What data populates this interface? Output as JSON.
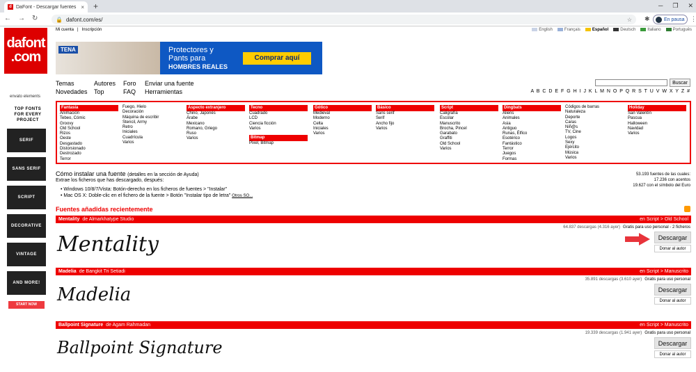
{
  "browser": {
    "tab_title": "DaFont - Descargar fuentes",
    "url": "dafont.com/es/",
    "profile": "En pausa"
  },
  "site": {
    "logo_line1": "dafont",
    "logo_line2": ".com",
    "toplinks": [
      "Mi cuenta",
      "Inscripción"
    ],
    "languages": [
      {
        "name": "English",
        "color": "#c9d3e6"
      },
      {
        "name": "Français",
        "color": "#9ab1d9"
      },
      {
        "name": "Español",
        "color": "#f5c400",
        "selected": true
      },
      {
        "name": "Deutsch",
        "color": "#333333"
      },
      {
        "name": "Italiano",
        "color": "#3a9a3a"
      },
      {
        "name": "Português",
        "color": "#2f7d32"
      }
    ],
    "ad": {
      "brand": "TENA",
      "line1": "Protectores y",
      "line2": "Pants para",
      "line3": "HOMBRES REALES",
      "cta": "Comprar aquí"
    },
    "envato": {
      "logo": "envato elements",
      "headline": "TOP FONTS FOR EVERY PROJECT",
      "tiles": [
        "SERIF",
        "SANS SERIF",
        "SCRIPT",
        "DECORATIVE",
        "VINTAGE",
        "AND MORE!"
      ],
      "cta": "START NOW"
    },
    "menu": [
      {
        "label": "Temas"
      },
      {
        "label": "Autores"
      },
      {
        "label": "Foro"
      },
      {
        "label": "Enviar una fuente"
      },
      {
        "label": "Novedades"
      },
      {
        "label": "Top"
      },
      {
        "label": "FAQ"
      },
      {
        "label": "Herramientas"
      }
    ],
    "search_button": "Buscar",
    "alphabet": "A B C D E F G H I J K L M N O P Q R S T U V W X Y Z #",
    "categories": [
      {
        "title": "Fantasía",
        "items": [
          "Animación",
          "Tebeo, Cómic",
          "Groovy",
          "Old School",
          "Rizos",
          "Oeste",
          "Desgastado",
          "Distorsionado",
          "Destrozado",
          "Terror"
        ]
      },
      {
        "title": "",
        "items": [
          "Fuego, Hielo",
          "Decoración",
          "Máquina de escribir",
          "Stencil, Army",
          "Retro",
          "Iniciales",
          "Cuadrícula",
          "Varios"
        ]
      },
      {
        "title": "Aspecto extranjero",
        "items": [
          "Chino, Japonés",
          "Árabe",
          "Mexicano",
          "Romano, Griego",
          "Ruso",
          "Varios"
        ]
      },
      {
        "title": "Tecno",
        "items": [
          "Cuadrado",
          "LCD",
          "Ciencia ficción",
          "Varios"
        ],
        "sub": {
          "title": "Bitmap",
          "items": [
            "Pixel, Bitmap"
          ]
        }
      },
      {
        "title": "Gótico",
        "items": [
          "Medieval",
          "Moderno",
          "Celta",
          "Iniciales",
          "Varios"
        ]
      },
      {
        "title": "Básico",
        "items": [
          "Sans serif",
          "Serif",
          "Ancho fijo",
          "Varios"
        ]
      },
      {
        "title": "Script",
        "items": [
          "Caligrafía",
          "Escolar",
          "Manuscrito",
          "Brocha, Pincel",
          "Garabato",
          "Graffiti",
          "Old School",
          "Varios"
        ]
      },
      {
        "title": "Dingbats",
        "items": [
          "Aliens",
          "Animales",
          "Asia",
          "Antiguo",
          "Runas, Élfico",
          "Esotérico",
          "Fantástico",
          "Terror",
          "Juegos",
          "Formas"
        ]
      },
      {
        "title": "",
        "items": [
          "Códigos de barras",
          "Naturaleza",
          "Deporte",
          "Caras",
          "Niñ@s",
          "TV, Cine",
          "Logos",
          "Sexy",
          "Ejército",
          "Música",
          "Varios"
        ]
      },
      {
        "title": "Holiday",
        "items": [
          "San Valentín",
          "Pascua",
          "Halloween",
          "Navidad",
          "Varios"
        ]
      }
    ],
    "howto": {
      "title": "Cómo instalar una fuente",
      "note": "(detalles en la sección de Ayuda)",
      "sub": "Extrae los ficheros que has descargado, después:",
      "win": "Windows 10/8/7/Vista: Botón-derecho en los ficheros de fuentes > \"Instalar\"",
      "mac": "Mac OS X: Doble-clic en el fichero de la fuente > Botón \"Instalar tipo de letra\"",
      "other": "Otros SO..."
    },
    "stats": {
      "line1": "53.193 fuentes de las cuales:",
      "line2": "17.236 con acentos",
      "line3": "19.627 con el símbolo del Euro"
    },
    "recent_title": "Fuentes añadidas recientemente",
    "fonts": [
      {
        "name": "Mentality",
        "author": "de Almarkhatype Studio",
        "category": "en Script > Old School",
        "downloads": "64.837 descargas (4.316 ayer)",
        "license": "Gratis para uso personal - 2 ficheros",
        "sample": "Mentality",
        "download": "Descargar",
        "donate": "Donar al autor"
      },
      {
        "name": "Madelia",
        "author": "de Bangkit Tri Setiadi",
        "category": "en Script > Manuscrito",
        "downloads": "35.891 descargas (3.610 ayer)",
        "license": "Gratis para uso personal",
        "sample": "Madelia",
        "download": "Descargar",
        "donate": "Donar al autor"
      },
      {
        "name": "Ballpoint Signature",
        "author": "de Agam Rahmadan",
        "category": "en Script > Manuscrito",
        "downloads": "19.339 descargas (1.941 ayer)",
        "license": "Gratis para uso personal",
        "sample": "Ballpoint Signature",
        "download": "Descargar",
        "donate": "Donar al autor"
      }
    ]
  }
}
